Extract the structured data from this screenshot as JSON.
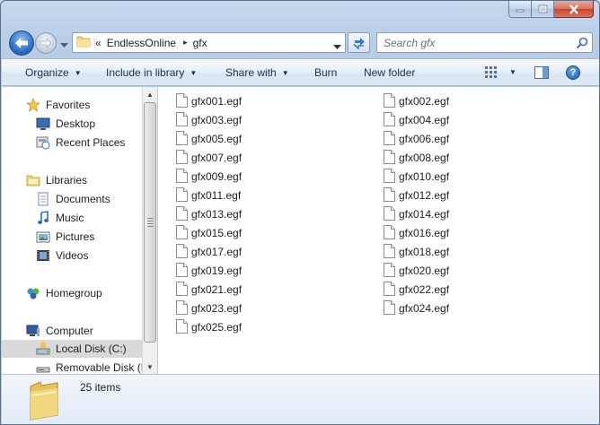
{
  "window": {
    "controls": {
      "minimize": "minimize-icon",
      "maximize": "maximize-icon",
      "close": "close-icon"
    }
  },
  "address_bar": {
    "overflow_chevron": "«",
    "breadcrumbs": [
      "EndlessOnline",
      "gfx"
    ],
    "separator": "▸"
  },
  "search": {
    "placeholder": "Search gfx"
  },
  "toolbar": {
    "organize": "Organize",
    "include_in_library": "Include in library",
    "share_with": "Share with",
    "burn": "Burn",
    "new_folder": "New folder",
    "help": "?"
  },
  "nav_pane": {
    "items": [
      {
        "label": "Favorites",
        "icon": "star-icon"
      },
      {
        "label": "Desktop",
        "icon": "desktop-icon"
      },
      {
        "label": "Recent Places",
        "icon": "recent-places-icon"
      },
      {
        "label": "Libraries",
        "icon": "libraries-icon"
      },
      {
        "label": "Documents",
        "icon": "documents-icon"
      },
      {
        "label": "Music",
        "icon": "music-icon"
      },
      {
        "label": "Pictures",
        "icon": "pictures-icon"
      },
      {
        "label": "Videos",
        "icon": "videos-icon"
      },
      {
        "label": "Homegroup",
        "icon": "homegroup-icon"
      },
      {
        "label": "Computer",
        "icon": "computer-icon"
      },
      {
        "label": "Local Disk (C:)",
        "icon": "local-disk-icon",
        "selected": true
      },
      {
        "label": "Removable Disk (K",
        "icon": "removable-disk-icon"
      }
    ]
  },
  "files": [
    "gfx001.egf",
    "gfx002.egf",
    "gfx003.egf",
    "gfx004.egf",
    "gfx005.egf",
    "gfx006.egf",
    "gfx007.egf",
    "gfx008.egf",
    "gfx009.egf",
    "gfx010.egf",
    "gfx011.egf",
    "gfx012.egf",
    "gfx013.egf",
    "gfx014.egf",
    "gfx015.egf",
    "gfx016.egf",
    "gfx017.egf",
    "gfx018.egf",
    "gfx019.egf",
    "gfx020.egf",
    "gfx021.egf",
    "gfx022.egf",
    "gfx023.egf",
    "gfx024.egf",
    "gfx025.egf"
  ],
  "details": {
    "item_count": "25 items"
  },
  "colors": {
    "selection": "#d9d9d9",
    "accent": "#2c70c8",
    "close_button": "#c7452a"
  }
}
